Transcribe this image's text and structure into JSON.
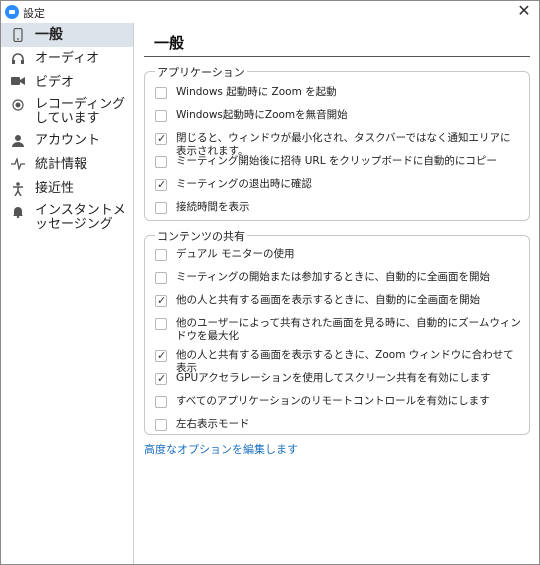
{
  "window": {
    "title": "設定"
  },
  "sidebar": {
    "items": [
      {
        "label": "一般",
        "icon": "phone-icon"
      },
      {
        "label": "オーディオ",
        "icon": "headphones-icon"
      },
      {
        "label": "ビデオ",
        "icon": "video-camera-icon"
      },
      {
        "label": "レコーディングしています",
        "icon": "record-icon"
      },
      {
        "label": "アカウント",
        "icon": "user-icon"
      },
      {
        "label": "統計情報",
        "icon": "pulse-icon"
      },
      {
        "label": "接近性",
        "icon": "accessibility-icon"
      },
      {
        "label": "インスタントメッセージング",
        "icon": "bell-icon"
      }
    ]
  },
  "main": {
    "title": "一般",
    "application": {
      "legend": "アプリケーション",
      "options": [
        {
          "label": "Windows 起動時に Zoom を起動",
          "checked": false
        },
        {
          "label": "Windows起動時にZoomを無音開始",
          "checked": false
        },
        {
          "label": "閉じると、ウィンドウが最小化され、タスクバーではなく通知エリアに表示されます。",
          "checked": true
        },
        {
          "label": "ミーティング開始後に招待 URL をクリップボードに自動的にコピー",
          "checked": false
        },
        {
          "label": "ミーティングの退出時に確認",
          "checked": true
        },
        {
          "label": "接続時間を表示",
          "checked": false
        }
      ]
    },
    "content_sharing": {
      "legend": "コンテンツの共有",
      "options": [
        {
          "label": "デュアル モニターの使用",
          "checked": false
        },
        {
          "label": "ミーティングの開始または参加するときに、自動的に全画面を開始",
          "checked": false
        },
        {
          "label": "他の人と共有する画面を表示するときに、自動的に全画面を開始",
          "checked": true
        },
        {
          "label": "他のユーザーによって共有された画面を見る時に、自動的にズームウィンドウを最大化",
          "checked": false
        },
        {
          "label": "他の人と共有する画面を表示するときに、Zoom ウィンドウに合わせて表示",
          "checked": true
        },
        {
          "label": "GPUアクセラレーションを使用してスクリーン共有を有効にします",
          "checked": true
        },
        {
          "label": "すべてのアプリケーションのリモートコントロールを有効にします",
          "checked": false
        },
        {
          "label": "左右表示モード",
          "checked": false
        }
      ]
    },
    "advanced_link": "高度なオプションを編集します"
  }
}
